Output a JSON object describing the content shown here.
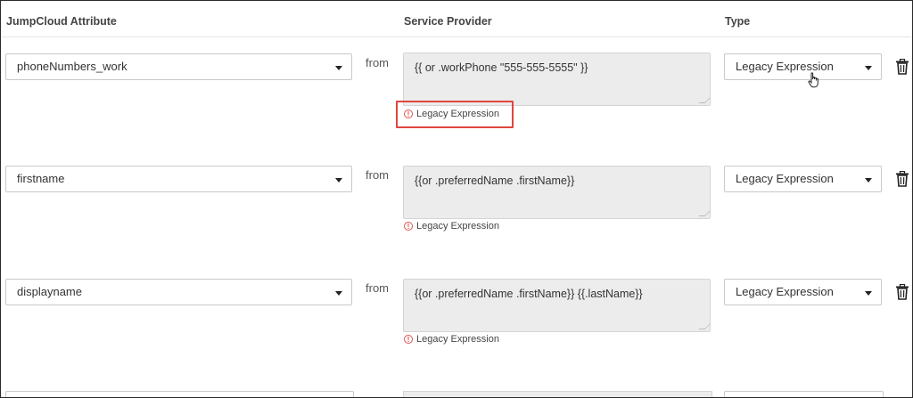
{
  "headers": {
    "jumpcloud_attribute": "JumpCloud Attribute",
    "service_provider": "Service Provider",
    "type": "Type"
  },
  "rows": [
    {
      "attribute": "phoneNumbers_work",
      "from_label": "from",
      "expression": "{{ or .workPhone \"555-555-5555\" }}",
      "warning": "Legacy Expression",
      "type": "Legacy Expression"
    },
    {
      "attribute": "firstname",
      "from_label": "from",
      "expression": "{{or .preferredName .firstName}}",
      "warning": "Legacy Expression",
      "type": "Legacy Expression"
    },
    {
      "attribute": "displayname",
      "from_label": "from",
      "expression": "{{or .preferredName .firstName}} {{.lastName}}",
      "warning": "Legacy Expression",
      "type": "Legacy Expression"
    }
  ],
  "colors": {
    "highlight": "#e0463d",
    "warning_icon": "#d9534f",
    "expression_bg": "#ececec"
  },
  "icons": [
    "chevron-down-icon",
    "trash-icon",
    "warning-circle-icon",
    "hand-cursor-icon"
  ]
}
